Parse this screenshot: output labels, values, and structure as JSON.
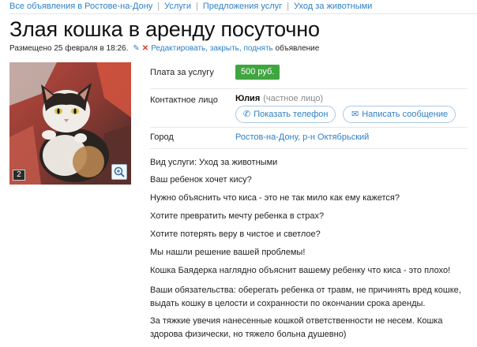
{
  "breadcrumbs": [
    "Все объявления в Ростове-на-Дону",
    "Услуги",
    "Предложения услуг",
    "Уход за животными"
  ],
  "title": "Злая кошка в аренду посуточно",
  "meta": {
    "posted": "Размещено 25 февраля в 18:26.",
    "actions": "Редактировать, закрыть, поднять",
    "actions_tail": "объявление"
  },
  "photo": {
    "count": "2"
  },
  "details": {
    "price_label": "Плата за услугу",
    "price": "500 руб.",
    "contact_label": "Контактное лицо",
    "seller_name": "Юлия",
    "seller_type": "(частное лицо)",
    "show_phone": "Показать телефон",
    "write_message": "Написать сообщение",
    "city_label": "Город",
    "city": "Ростов-на-Дону, р-н Октябрьский"
  },
  "description": [
    "Вид услуги: Уход за животными",
    "Ваш ребенок хочет кису?",
    "Нужно объяснить что киса - это не так мило как ему кажется?",
    "Хотите превратить мечту ребенка в страх?",
    "Хотите потерять веру в чистое и светлое?",
    "Мы нашли решение вашей проблемы!",
    "Кошка Баядерка наглядно объяснит вашему ребенку что киса - это плохо!",
    "Ваши обязательства: оберегать ребенка от травм, не причинять вред кошке, выдать кошку в целости и сохранности по окончании срока аренды.",
    "За тяжкие увечия нанесенные кошкой ответственности не несем. Кошка здорова физически, но тяжело больна душевно)"
  ],
  "colors": {
    "link": "#2f7fc6",
    "price_badge": "#3fa63f",
    "delete": "#d43b32"
  },
  "icons": [
    "pencil-icon",
    "close-icon",
    "phone-icon",
    "envelope-icon",
    "zoom-icon"
  ]
}
